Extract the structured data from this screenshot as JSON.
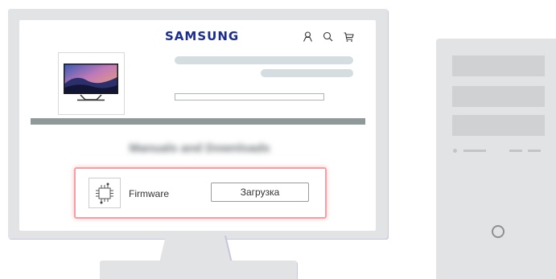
{
  "site": {
    "brand": "SAMSUNG",
    "header_icons": [
      "user-icon",
      "search-icon",
      "cart-icon"
    ],
    "blurred_heading": "Manuals and Downloads",
    "firmware_label": "Firmware",
    "download_button": "Загрузка"
  },
  "colors": {
    "brand": "#1c2d8f",
    "highlight_border": "#f2a0a4",
    "device_body": "#e2e3e5",
    "divider": "#8e9a9a"
  },
  "devices": [
    "monitor",
    "pc-tower"
  ]
}
